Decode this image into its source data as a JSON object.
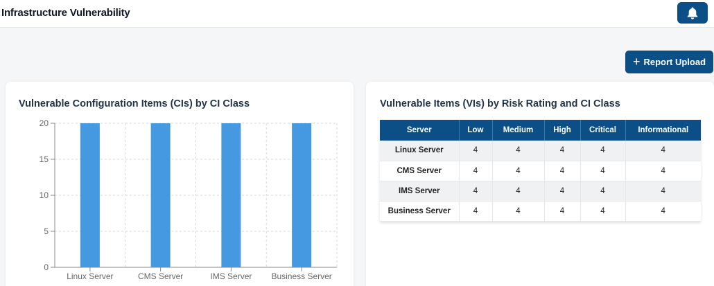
{
  "header": {
    "title": "Infrastructure Vulnerability",
    "notification_icon": "bell-icon"
  },
  "actions": {
    "report_upload_label": "Report Upload",
    "report_upload_icon": "plus-icon"
  },
  "colors": {
    "primary": "#0b4f86",
    "bar": "#4499e0"
  },
  "ci_chart": {
    "title": "Vulnerable Configuration Items (CIs) by CI Class"
  },
  "chart_data": {
    "type": "bar",
    "title": "Vulnerable Configuration Items (CIs) by CI Class",
    "categories": [
      "Linux Server",
      "CMS Server",
      "IMS Server",
      "Business Server"
    ],
    "values": [
      20,
      20,
      20,
      20
    ],
    "xlabel": "",
    "ylabel": "",
    "ylim": [
      0,
      20
    ],
    "yticks": [
      0,
      5,
      10,
      15,
      20
    ],
    "grid": true
  },
  "vi_table": {
    "title": "Vulnerable Items (VIs) by Risk Rating and CI Class",
    "columns": [
      "Server",
      "Low",
      "Medium",
      "High",
      "Critical",
      "Informational"
    ],
    "rows": [
      [
        "Linux Server",
        "4",
        "4",
        "4",
        "4",
        "4"
      ],
      [
        "CMS Server",
        "4",
        "4",
        "4",
        "4",
        "4"
      ],
      [
        "IMS Server",
        "4",
        "4",
        "4",
        "4",
        "4"
      ],
      [
        "Business Server",
        "4",
        "4",
        "4",
        "4",
        "4"
      ]
    ]
  }
}
